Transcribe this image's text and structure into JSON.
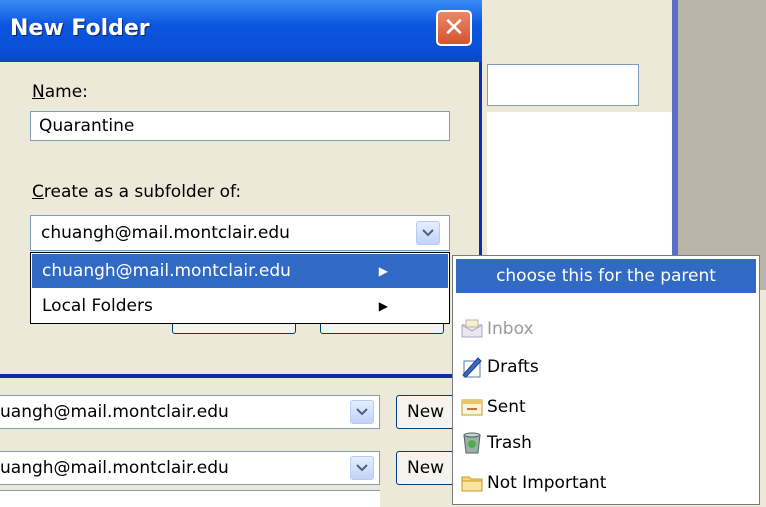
{
  "dialog": {
    "title": "New Folder",
    "name_label": "Name:",
    "name_value": "Quarantine",
    "parent_label": "Create as a subfolder of:",
    "parent_value": "chuangh@mail.montclair.edu"
  },
  "dropdown": {
    "items": [
      {
        "label": "chuangh@mail.montclair.edu",
        "selected": true
      },
      {
        "label": "Local Folders",
        "selected": false
      }
    ]
  },
  "submenu": {
    "header": "choose this for the parent",
    "items": [
      {
        "label": "Inbox",
        "icon": "inbox-icon",
        "disabled": true
      },
      {
        "label": "Drafts",
        "icon": "drafts-icon",
        "disabled": false
      },
      {
        "label": "Sent",
        "icon": "sent-icon",
        "disabled": false
      },
      {
        "label": "Trash",
        "icon": "trash-icon",
        "disabled": false
      },
      {
        "label": "Not Important",
        "icon": "folder-icon",
        "disabled": false
      }
    ]
  },
  "background": {
    "row1_value": "uangh@mail.montclair.edu",
    "row2_value": "uangh@mail.montclair.edu",
    "new_label": "New"
  },
  "colors": {
    "titlebar": "#0B56E0",
    "highlight": "#316AC5",
    "window_bg": "#ECE9D8"
  }
}
